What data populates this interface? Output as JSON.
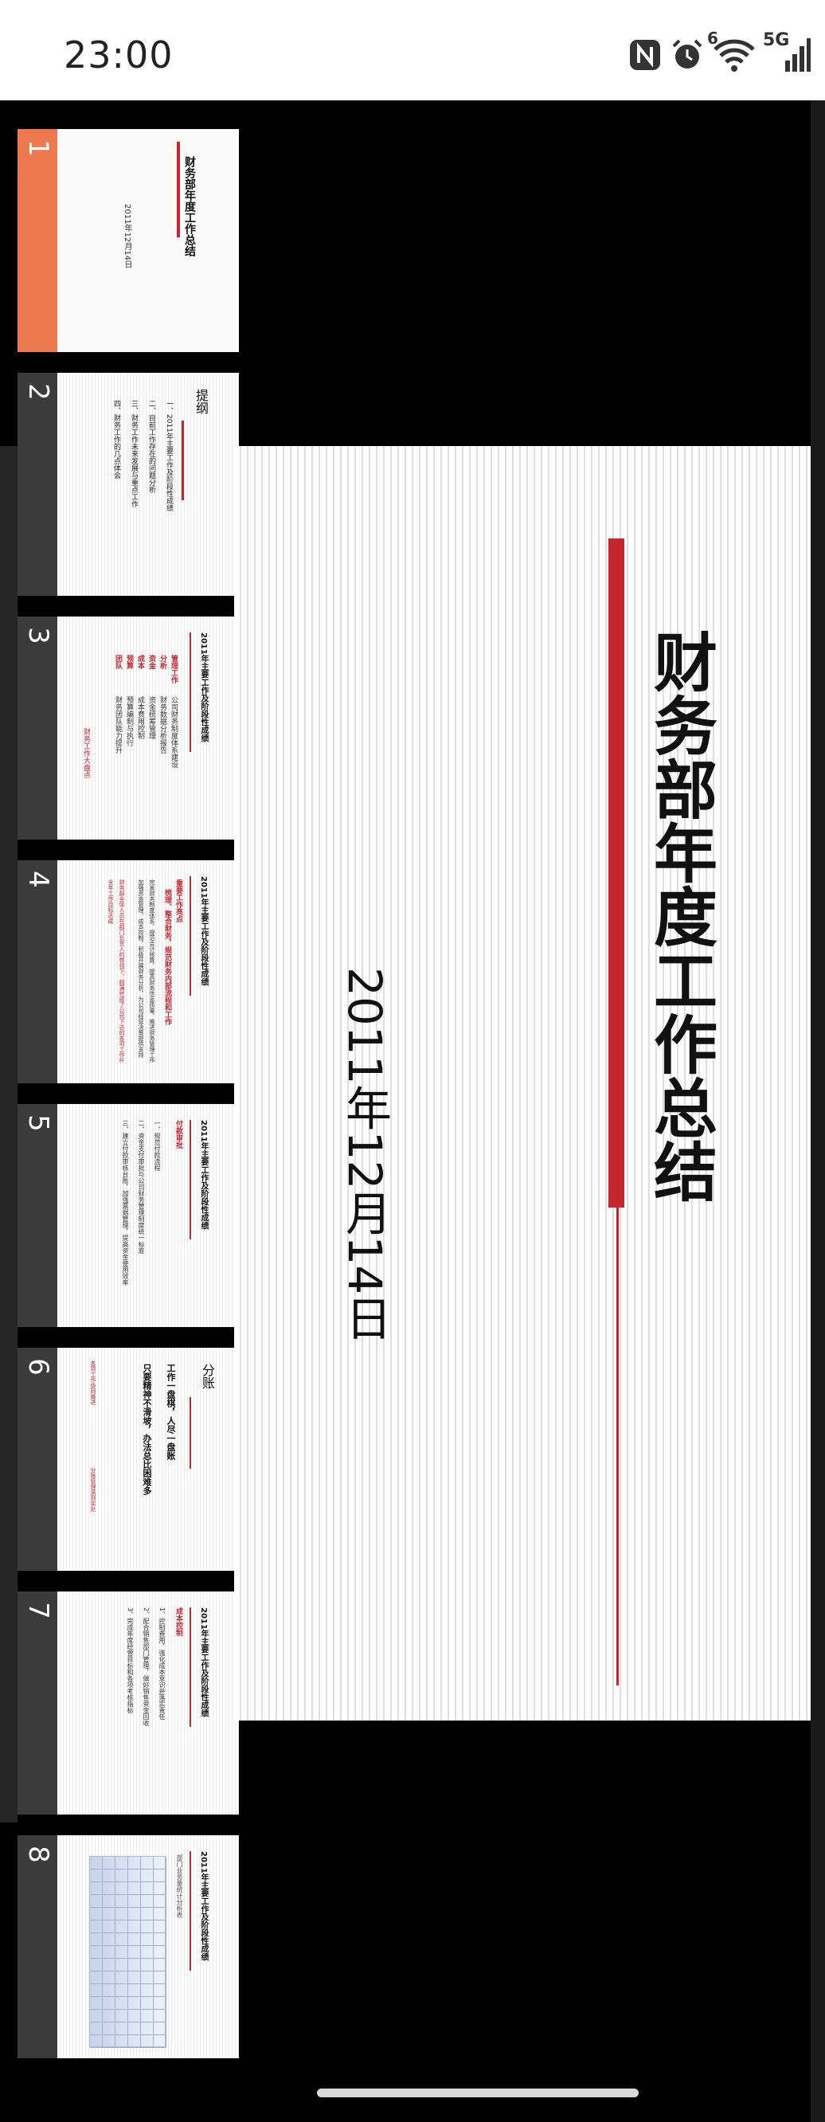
{
  "status_bar": {
    "time": "23:00",
    "icons": [
      "nfc-icon",
      "alarm-icon",
      "wifi-icon",
      "signal-5g-icon"
    ],
    "wifi_badge": "6",
    "network": "5G"
  },
  "thumbnails": [
    {
      "number": "1",
      "title": "财务部年度工作总结",
      "date": "2011年12月14日"
    },
    {
      "number": "2",
      "title": "提纲",
      "items": [
        "一、2011年主要工作及阶段性成绩",
        "二、目前工作存在的问题分析",
        "三、财务工作未来发展与重点工作",
        "四、财务工作的几点体会"
      ]
    },
    {
      "number": "3",
      "title": "2011年主要工作及阶段性成绩",
      "labels": [
        "管理工作",
        "分析",
        "资金",
        "成本",
        "预算",
        "团队"
      ],
      "descs": [
        "公司财务制度体系建设",
        "财务数据分析报告",
        "资金统筹管理",
        "成本费用控制",
        "预算编制与执行",
        "财务团队能力提升"
      ],
      "footer": "财务工作大盘点"
    },
    {
      "number": "4",
      "title": "2011年主要工作及阶段性成绩",
      "heading": "重要工作亮点",
      "sub": "梳理、整合财务，规范财务内部流程和工作",
      "para1": "完善财务制度体系，规范会计核算，提高财务信息质量，推进财务管理工作",
      "para2": "加强资金管理、成本控制，积极开展财务分析，为公司经营决策提供支持",
      "para3": "财务部全体人员在部门负责人的带领下，圆满完成了公司下达的各项工作任务",
      "note": "全年工作目标达成"
    },
    {
      "number": "5",
      "title": "2011年主要工作及阶段性成绩",
      "heading": "付款审批",
      "items": [
        "一、规范付款流程",
        "二、资金支付审批与公司财务管理制度统一标准",
        "三、建立付款审核台账，加强票据管理，提高资金使用效率"
      ]
    },
    {
      "number": "6",
      "title": "分账",
      "line1": "工作一盘棋，人尽一盘账",
      "line2": "只要精神不滑坡，办法总比困难多",
      "footer_left": "各项工作协同推进",
      "footer_right": "分账管理落到实处"
    },
    {
      "number": "7",
      "title": "2011年主要工作及阶段性成绩",
      "heading": "成本控制",
      "items": [
        "1、控制费用，强化成本意识并落实责任",
        "2、配合销售部门管理，做好销售资金回收",
        "3、完成年度经营目标和各项考核指标"
      ]
    },
    {
      "number": "8",
      "title": "2011年主要工作及阶段性成绩",
      "caption": "部门业务量统计分析表"
    }
  ],
  "main_slide": {
    "title": "财务部年度工作总结",
    "date": "2011年12月14日",
    "accent_color": "#c4262e"
  }
}
